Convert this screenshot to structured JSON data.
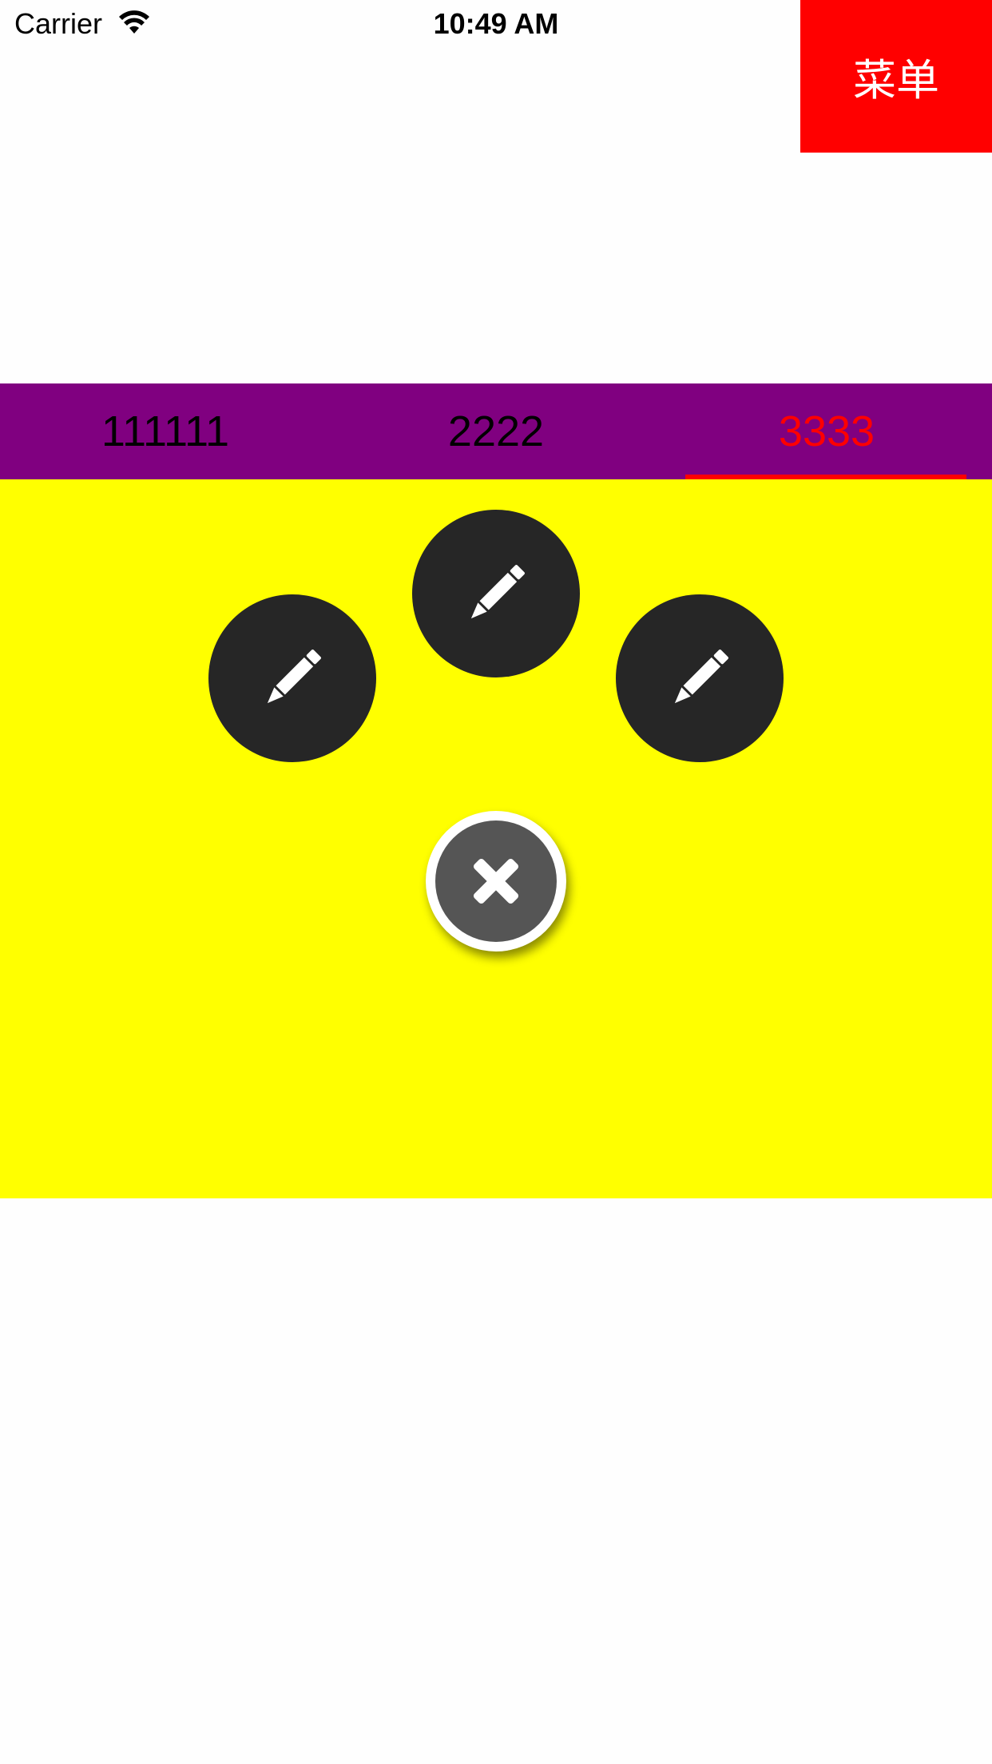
{
  "status_bar": {
    "carrier": "Carrier",
    "time": "10:49 AM",
    "wifi_icon": "wifi-icon",
    "battery_icon": "battery-icon"
  },
  "menu": {
    "label": "菜单",
    "color": "#ff0000"
  },
  "tabs": {
    "items": [
      {
        "label": "111111"
      },
      {
        "label": "2222"
      },
      {
        "label": "3333"
      }
    ],
    "selected_index": 2,
    "background": "#800080",
    "selected_color": "#ff0000"
  },
  "panel": {
    "background": "#ffff00",
    "action_buttons": [
      {
        "icon": "pencil-icon"
      },
      {
        "icon": "pencil-icon"
      },
      {
        "icon": "pencil-icon"
      }
    ],
    "close_button": {
      "icon": "close-icon"
    }
  }
}
